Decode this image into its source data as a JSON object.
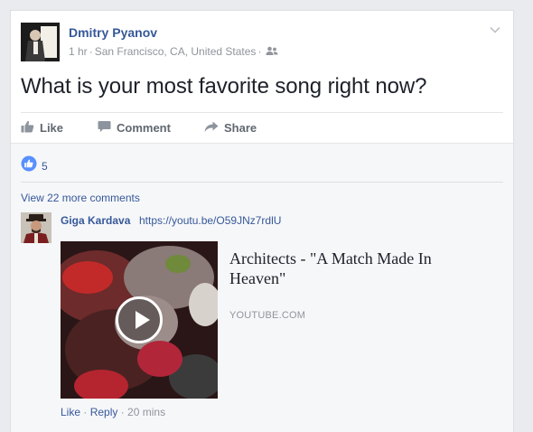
{
  "post": {
    "author": "Dmitry Pyanov",
    "time": "1 hr",
    "location": "San Francisco, CA, United States",
    "audience_icon": "friends-icon",
    "text": "What is your most favorite song right now?"
  },
  "actions": {
    "like": "Like",
    "comment": "Comment",
    "share": "Share"
  },
  "reactions": {
    "count": "5",
    "icon": "like-reaction-icon"
  },
  "comments": {
    "view_more": "View 22 more comments",
    "items": [
      {
        "author": "Giga Kardava",
        "text": "https://youtu.be/O59JNz7rdlU",
        "preview": {
          "title": "Architects - \"A Match Made In Heaven\"",
          "domain": "YOUTUBE.COM"
        },
        "like": "Like",
        "reply": "Reply",
        "time": "20 mins"
      }
    ]
  },
  "colors": {
    "link": "#365899",
    "meta": "#90949c",
    "background": "#e9ebee",
    "reaction_blue": "#5890ff"
  }
}
